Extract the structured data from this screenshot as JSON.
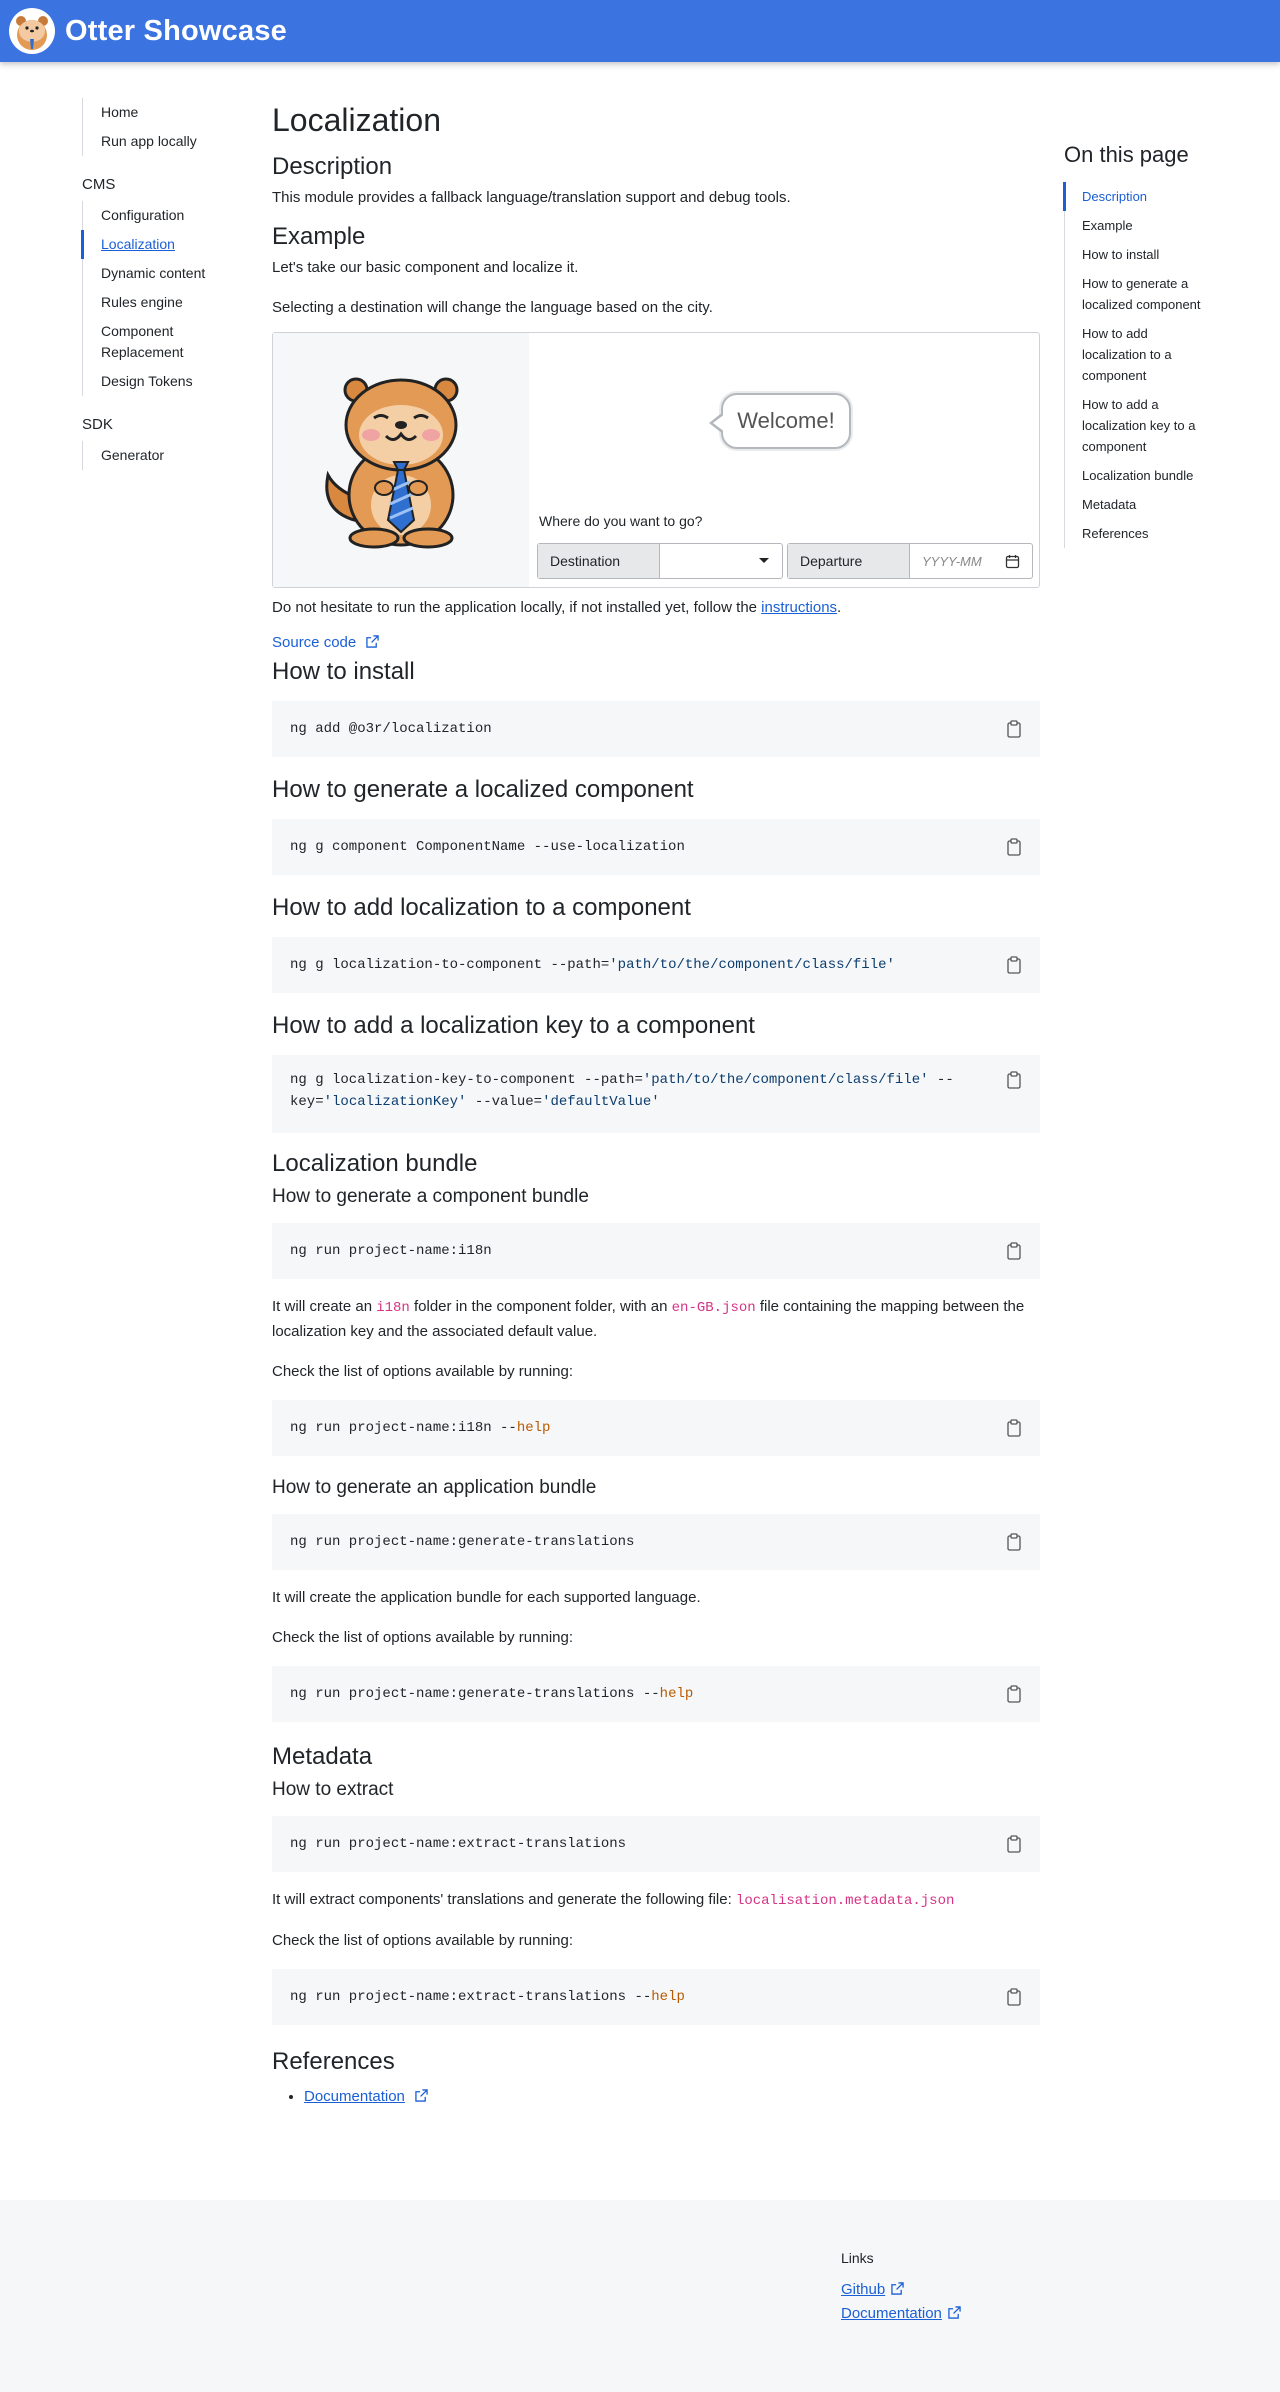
{
  "header": {
    "title": "Otter Showcase",
    "logo_icon": "otter-logo-icon"
  },
  "sidebar": {
    "top_items": [
      {
        "label": "Home"
      },
      {
        "label": "Run app locally"
      }
    ],
    "cms": {
      "title": "CMS",
      "items": [
        {
          "label": "Configuration"
        },
        {
          "label": "Localization"
        },
        {
          "label": "Dynamic content"
        },
        {
          "label": "Rules engine"
        },
        {
          "label": "Component Replacement"
        },
        {
          "label": "Design Tokens"
        }
      ]
    },
    "sdk": {
      "title": "SDK",
      "items": [
        {
          "label": "Generator"
        }
      ]
    }
  },
  "main": {
    "title": "Localization",
    "description": {
      "heading": "Description",
      "text": "This module provides a fallback language/translation support and debug tools."
    },
    "example": {
      "heading": "Example",
      "p1": "Let's take our basic component and localize it.",
      "p2": "Selecting a destination will change the language based on the city.",
      "demo": {
        "welcome": "Welcome!",
        "question": "Where do you want to go?",
        "destination_label": "Destination",
        "departure_label": "Departure",
        "departure_placeholder": "YYYY-MM"
      },
      "note_before": "Do not hesitate to run the application locally, if not installed yet, follow the ",
      "note_link": "instructions",
      "note_after": ".",
      "source_code": "Source code"
    },
    "install": {
      "heading": "How to install",
      "code": "ng add @o3r/localization"
    },
    "generate_component": {
      "heading": "How to generate a localized component",
      "code": "ng g component ComponentName --use-localization"
    },
    "add_localization": {
      "heading": "How to add localization to a component",
      "code_prefix": "ng g localization-to-component --path=",
      "code_str": "'path/to/the/component/class/file'"
    },
    "add_key": {
      "heading": "How to add a localization key to a component",
      "l1_prefix": "ng g localization-key-to-component --path=",
      "l1_str": "'path/to/the/component/class/file'",
      "l1_suffix": " --",
      "l2_prefix": "key=",
      "l2_str1": "'localizationKey'",
      "l2_mid": " --value=",
      "l2_str2": "'defaultValue'"
    },
    "bundle": {
      "heading": "Localization bundle",
      "component": {
        "heading": "How to generate a component bundle",
        "code": "ng run project-name:i18n",
        "text_a": "It will create an ",
        "code_a": "i18n",
        "text_b": " folder in the component folder, with an ",
        "code_b": "en-GB.json",
        "text_c": " file containing the mapping between the localization key and the associated default value.",
        "options": "Check the list of options available by running:",
        "help_prefix": "ng run project-name:i18n --",
        "help_kw": "help"
      },
      "application": {
        "heading": "How to generate an application bundle",
        "code": "ng run project-name:generate-translations",
        "text": "It will create the application bundle for each supported language.",
        "options": "Check the list of options available by running:",
        "help_prefix": "ng run project-name:generate-translations --",
        "help_kw": "help"
      }
    },
    "metadata": {
      "heading": "Metadata",
      "extract_heading": "How to extract",
      "code": "ng run project-name:extract-translations",
      "text": "It will extract components' translations and generate the following file: ",
      "file": "localisation.metadata.json",
      "options": "Check the list of options available by running:",
      "help_prefix": "ng run project-name:extract-translations --",
      "help_kw": "help"
    },
    "references": {
      "heading": "References",
      "link": "Documentation"
    }
  },
  "toc": {
    "title": "On this page",
    "items": [
      {
        "label": "Description"
      },
      {
        "label": "Example"
      },
      {
        "label": "How to install"
      },
      {
        "label": "How to generate a localized component"
      },
      {
        "label": "How to add localization to a component"
      },
      {
        "label": "How to add a localization key to a component"
      },
      {
        "label": "Localization bundle"
      },
      {
        "label": "Metadata"
      },
      {
        "label": "References"
      }
    ]
  },
  "footer": {
    "title": "Links",
    "links": [
      {
        "label": "Github"
      },
      {
        "label": "Documentation"
      }
    ]
  },
  "colors": {
    "primary": "#3b73e0",
    "link": "#1b5fd6",
    "inline_code": "#d63384",
    "code_bg": "#f6f7f9"
  }
}
